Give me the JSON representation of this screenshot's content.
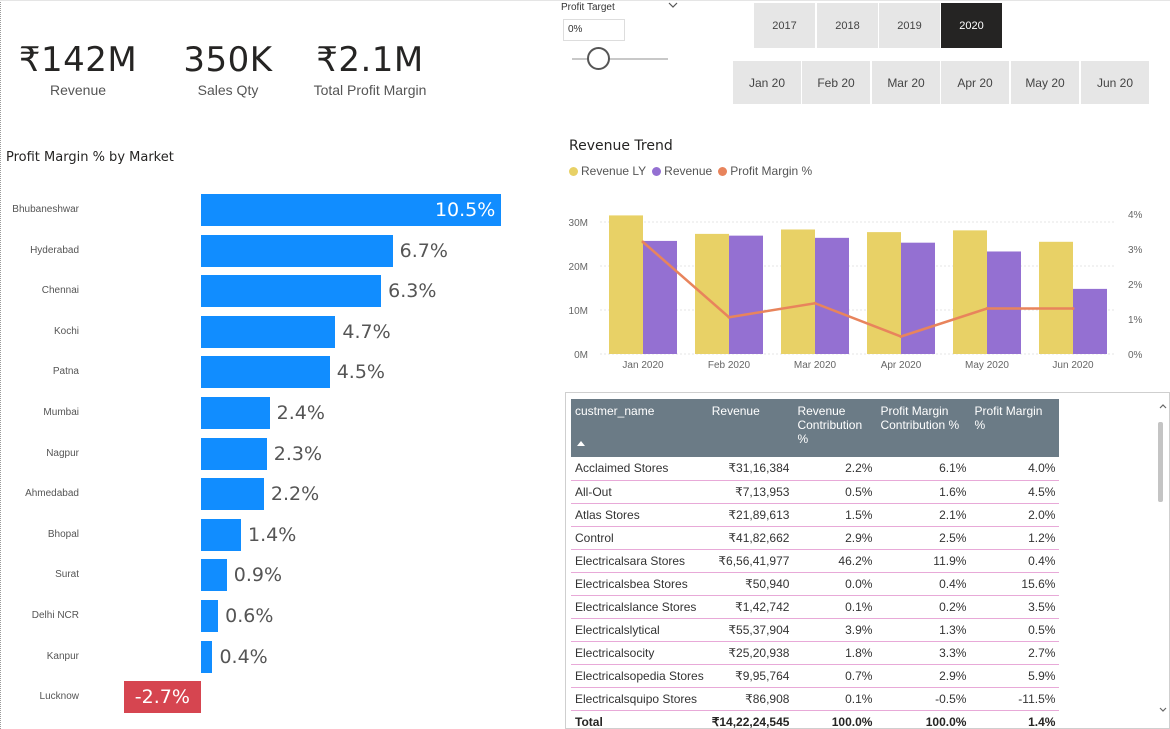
{
  "kpis": [
    {
      "value": "₹142M",
      "label": "Revenue"
    },
    {
      "value": "350K",
      "label": "Sales Qty"
    },
    {
      "value": "₹2.1M",
      "label": "Total Profit Margin"
    }
  ],
  "profit_target": {
    "title": "Profit Target",
    "value": "0%",
    "chevron_icon": "chevron-down-icon",
    "slider_level": 0
  },
  "years": {
    "items": [
      "2017",
      "2018",
      "2019",
      "2020"
    ],
    "selected": "2020"
  },
  "months": {
    "items": [
      "Jan 20",
      "Feb 20",
      "Mar 20",
      "Apr 20",
      "May 20",
      "Jun 20"
    ]
  },
  "market_chart": {
    "title": "Profit Margin % by Market",
    "positive_color": "#118DFF",
    "negative_color": "#D64550"
  },
  "trend_chart": {
    "title": "Revenue Trend",
    "legend": [
      {
        "name": "Revenue LY",
        "color": "#E8D166"
      },
      {
        "name": "Revenue",
        "color": "#9470D2"
      },
      {
        "name": "Profit Margin %",
        "color": "#E8845C"
      }
    ],
    "y_ticks": [
      "0M",
      "10M",
      "20M",
      "30M"
    ],
    "y2_ticks": [
      "0%",
      "1%",
      "2%",
      "3%",
      "4%"
    ]
  },
  "chart_data": [
    {
      "type": "bar",
      "title": "Profit Margin % by Market",
      "orientation": "horizontal",
      "categories": [
        "Bhubaneshwar",
        "Hyderabad",
        "Chennai",
        "Kochi",
        "Patna",
        "Mumbai",
        "Nagpur",
        "Ahmedabad",
        "Bhopal",
        "Surat",
        "Delhi NCR",
        "Kanpur",
        "Lucknow"
      ],
      "values": [
        10.5,
        6.7,
        6.3,
        4.7,
        4.5,
        2.4,
        2.3,
        2.2,
        1.4,
        0.9,
        0.6,
        0.4,
        -2.7
      ],
      "labels": [
        "10.5%",
        "6.7%",
        "6.3%",
        "4.7%",
        "4.5%",
        "2.4%",
        "2.3%",
        "2.2%",
        "1.4%",
        "0.9%",
        "0.6%",
        "0.4%",
        "-2.7%"
      ]
    },
    {
      "type": "bar",
      "title": "Revenue Trend",
      "categories": [
        "Jan 2020",
        "Feb 2020",
        "Mar 2020",
        "Apr 2020",
        "May 2020",
        "Jun 2020"
      ],
      "series": [
        {
          "name": "Revenue LY",
          "values": [
            31.5,
            27.3,
            28.3,
            27.7,
            28.1,
            25.5
          ]
        },
        {
          "name": "Revenue",
          "values": [
            25.7,
            26.9,
            26.4,
            25.3,
            23.3,
            14.8
          ]
        },
        {
          "name": "Profit Margin %",
          "values": [
            3.2,
            1.05,
            1.45,
            0.5,
            1.3,
            1.3
          ]
        }
      ],
      "ylim": [
        0,
        35
      ],
      "y2lim": [
        0,
        4.4
      ]
    }
  ],
  "table": {
    "headers": [
      "custmer_name",
      "Revenue",
      "Revenue Contribution %",
      "Profit Margin Contribution %",
      "Profit Margin %"
    ],
    "rows": [
      [
        "Acclaimed Stores",
        "₹31,16,384",
        "2.2%",
        "6.1%",
        "4.0%"
      ],
      [
        "All-Out",
        "₹7,13,953",
        "0.5%",
        "1.6%",
        "4.5%"
      ],
      [
        "Atlas Stores",
        "₹21,89,613",
        "1.5%",
        "2.1%",
        "2.0%"
      ],
      [
        "Control",
        "₹41,82,662",
        "2.9%",
        "2.5%",
        "1.2%"
      ],
      [
        "Electricalsara Stores",
        "₹6,56,41,977",
        "46.2%",
        "11.9%",
        "0.4%"
      ],
      [
        "Electricalsbea Stores",
        "₹50,940",
        "0.0%",
        "0.4%",
        "15.6%"
      ],
      [
        "Electricalslance Stores",
        "₹1,42,742",
        "0.1%",
        "0.2%",
        "3.5%"
      ],
      [
        "Electricalslytical",
        "₹55,37,904",
        "3.9%",
        "1.3%",
        "0.5%"
      ],
      [
        "Electricalsocity",
        "₹25,20,938",
        "1.8%",
        "3.3%",
        "2.7%"
      ],
      [
        "Electricalsopedia Stores",
        "₹9,95,764",
        "0.7%",
        "2.9%",
        "5.9%"
      ],
      [
        "Electricalsquipo Stores",
        "₹86,908",
        "0.1%",
        "-0.5%",
        "-11.5%"
      ]
    ],
    "total": [
      "Total",
      "₹14,22,24,545",
      "100.0%",
      "100.0%",
      "1.4%"
    ],
    "sort_icon": "sort-ascending-icon"
  }
}
